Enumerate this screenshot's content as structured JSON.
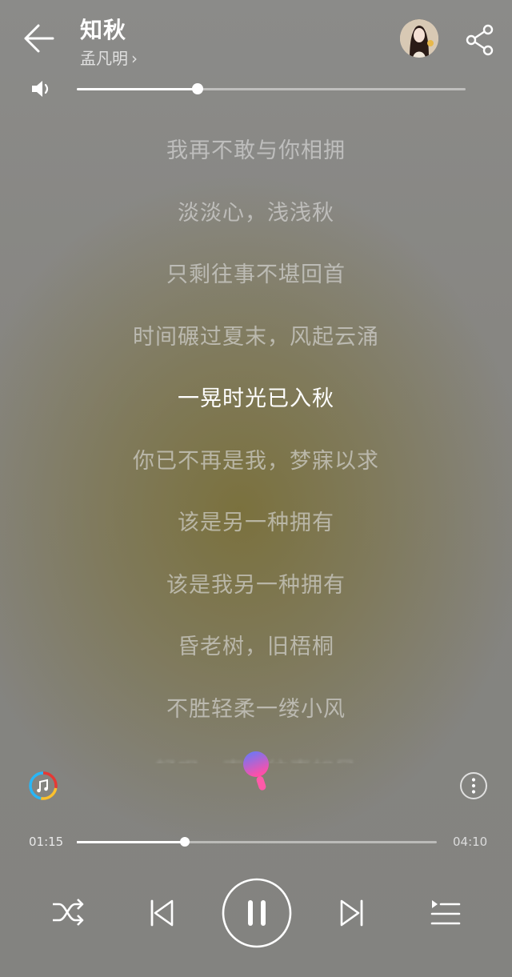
{
  "header": {
    "song_title": "知秋",
    "artist_name": "孟凡明",
    "artist_chevron": "›"
  },
  "volume": {
    "level": 0.31
  },
  "lyrics": [
    {
      "text": "我再不敢与你相拥",
      "state": "normal"
    },
    {
      "text": "淡淡心，浅浅秋",
      "state": "normal"
    },
    {
      "text": "只剩往事不堪回首",
      "state": "normal"
    },
    {
      "text": "时间碾过夏末，风起云涌",
      "state": "normal"
    },
    {
      "text": "一晃时光已入秋",
      "state": "active"
    },
    {
      "text": "你已不再是我，梦寐以求",
      "state": "normal"
    },
    {
      "text": "该是另一种拥有",
      "state": "normal"
    },
    {
      "text": "该是我另一种拥有",
      "state": "normal"
    },
    {
      "text": "昏老树，旧梧桐",
      "state": "normal"
    },
    {
      "text": "不胜轻柔一缕小风",
      "state": "normal"
    },
    {
      "text": "轻叹一声，往事如风",
      "state": "fading"
    }
  ],
  "playback": {
    "current_time": "01:15",
    "total_time": "04:10",
    "progress": 0.3
  },
  "icons": {
    "back": "arrow-left-icon",
    "share": "share-icon",
    "volume": "speaker-icon",
    "badge": "music-note-badge-icon",
    "karaoke": "microphone-icon",
    "more": "more-vertical-icon",
    "shuffle": "shuffle-icon",
    "prev": "skip-previous-icon",
    "play_pause": "pause-icon",
    "next": "skip-next-icon",
    "queue": "playlist-icon"
  },
  "colors": {
    "accent_active": "#ffffff",
    "karaoke_gradient_top": "#5b7cff",
    "karaoke_gradient_bottom": "#ff4fa8"
  }
}
